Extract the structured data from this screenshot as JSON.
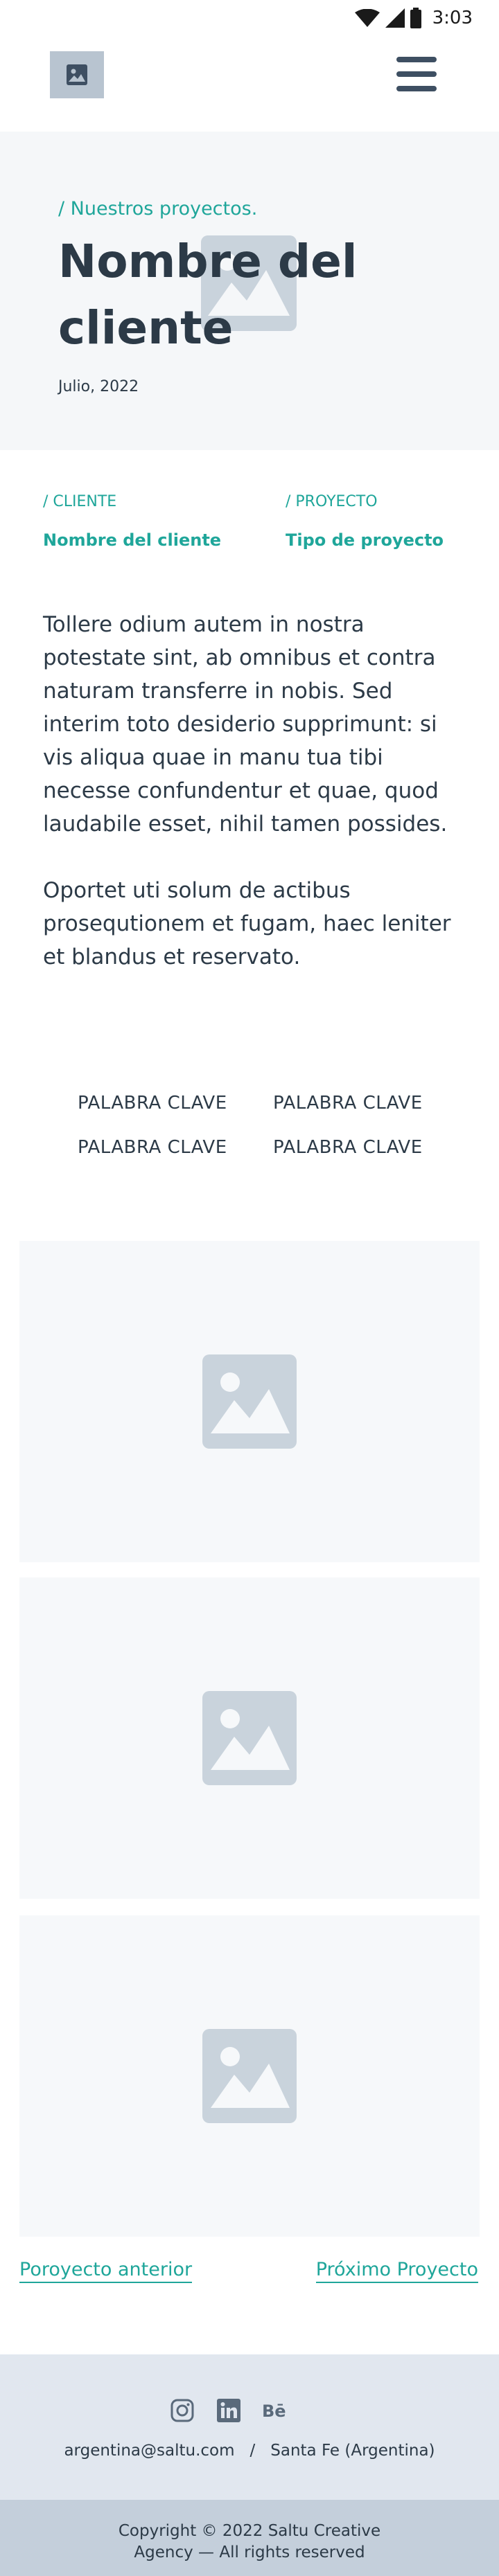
{
  "status_bar": {
    "time": "3:03"
  },
  "header": {
    "logo_icon": "image-placeholder-icon",
    "menu_icon": "hamburger-menu-icon"
  },
  "hero": {
    "breadcrumb": "/ Nuestros proyectos.",
    "title": "Nombre del cliente",
    "date": "Julio, 2022",
    "background_icon": "image-placeholder-icon"
  },
  "project_meta": {
    "client_label": "/ CLIENTE",
    "client_value": "Nombre del cliente",
    "project_label": "/ PROYECTO",
    "project_value": "Tipo de proyecto"
  },
  "description": {
    "paragraphs": [
      "Tollere odium autem in nostra potestate sint, ab omnibus et contra naturam transferre in nobis. Sed interim toto desiderio supprimunt: si vis aliqua quae in manu tua tibi necesse confundentur et quae, quod laudabile esset, nihil tamen possides.",
      "Oportet uti solum de actibus prosequtionem et fugam, haec leniter et blandus et reservato."
    ]
  },
  "keywords": [
    "PALABRA CLAVE",
    "PALABRA CLAVE",
    "PALABRA CLAVE",
    "PALABRA CLAVE"
  ],
  "gallery": {
    "count": 3,
    "icon": "image-placeholder-icon"
  },
  "project_nav": {
    "previous_label": "Poroyecto anterior",
    "next_label": "Próximo Proyecto"
  },
  "footer": {
    "social": [
      "instagram-icon",
      "linkedin-icon",
      "behance-icon"
    ],
    "email": "argentina@saltu.com",
    "separator": "/",
    "location": "Santa Fe (Argentina)",
    "copyright_line1": "Copyright © 2022 Saltu Creative",
    "copyright_line2": "Agency — All rights reserved"
  },
  "colors": {
    "accent": "#1fa69a",
    "text": "#2c3a47",
    "hero_bg": "#f5f7f9",
    "footer_bg": "#e1e7ef",
    "copyright_bg": "#c4cfdb",
    "placeholder": "#c9d3dc"
  }
}
